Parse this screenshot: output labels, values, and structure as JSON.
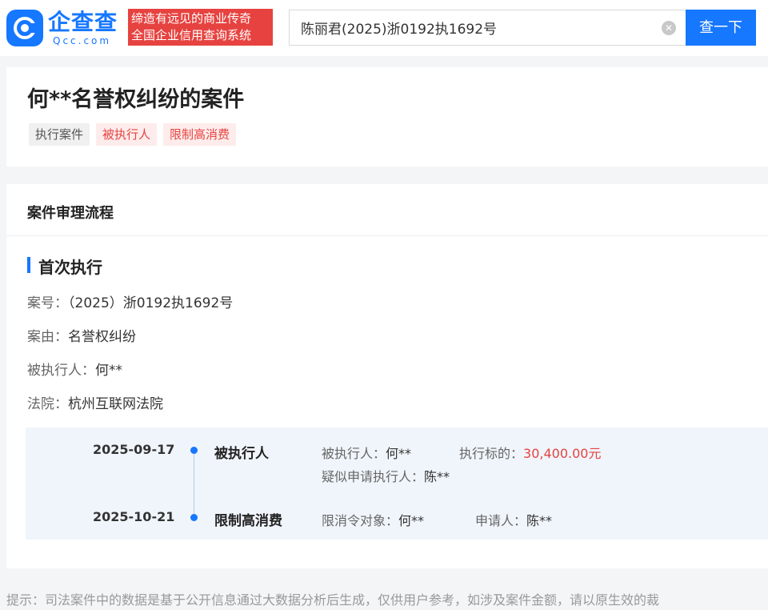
{
  "header": {
    "logo_text": "企查查",
    "logo_sub": "Qcc.com",
    "slogan_line1": "缔造有远见的商业传奇",
    "slogan_line2": "全国企业信用查询系统",
    "search_value": "陈丽君(2025)浙0192执1692号",
    "search_button": "查一下",
    "brand_color": "#1677ff",
    "slogan_color": "#e64340"
  },
  "case": {
    "title": "何**名誉权纠纷的案件",
    "tags": [
      "执行案件",
      "被执行人",
      "限制高消费"
    ]
  },
  "process": {
    "section_title": "案件审理流程",
    "stage_title": "首次执行",
    "fields": [
      {
        "label": "案号：",
        "value": "（2025）浙0192执1692号"
      },
      {
        "label": "案由：",
        "value": "名誉权纠纷"
      },
      {
        "label": "被执行人：",
        "value": "何**"
      },
      {
        "label": "法院：",
        "value": "杭州互联网法院"
      }
    ],
    "timeline": [
      {
        "date": "2025-09-17",
        "event": "被执行人",
        "d1_label": "被执行人：",
        "d1_value": "何**",
        "d2_label": "执行标的：",
        "d2_value": "30,400.00元",
        "d3_label": "疑似申请执行人：",
        "d3_value": "陈**"
      },
      {
        "date": "2025-10-21",
        "event": "限制高消费",
        "d1_label": "限消令对象：",
        "d1_value": "何**",
        "d2_label": "申请人：",
        "d2_value": "陈**"
      }
    ]
  },
  "footer": {
    "tip": "提示：司法案件中的数据是基于公开信息通过大数据分析后生成，仅供用户参考，如涉及案件金额，请以原生效的裁"
  }
}
